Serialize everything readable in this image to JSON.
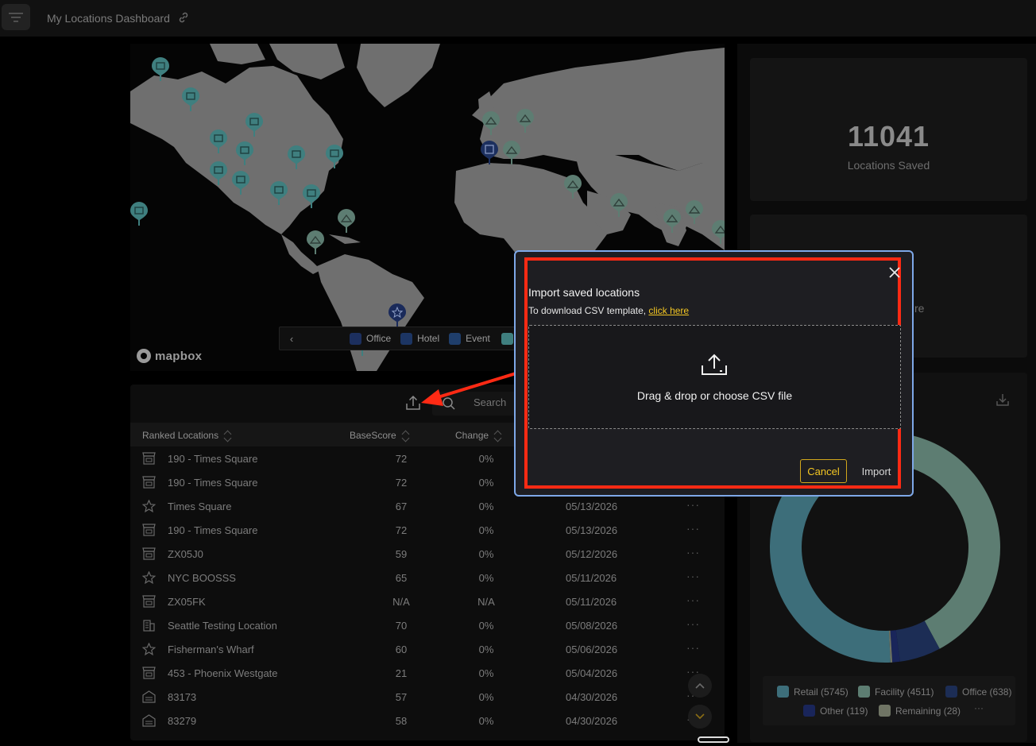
{
  "header": {
    "title": "My Locations Dashboard",
    "filter_icon": "filter-icon",
    "link_icon": "link-icon"
  },
  "map": {
    "legend": [
      {
        "label": "Office",
        "color": "#1c2f5e"
      },
      {
        "label": "Hotel",
        "color": "#1c3563"
      },
      {
        "label": "Event",
        "color": "#1f3e6b"
      }
    ],
    "attribution": "mapbox",
    "colors": {
      "land": "#8a8a8a",
      "water": "#050505",
      "pin": "#3f7f7f",
      "pin_special": "#1a2a5a"
    }
  },
  "table": {
    "search_placeholder": "Search",
    "columns": {
      "name": "Ranked Locations",
      "score": "BaseScore",
      "change": "Change"
    },
    "rows": [
      {
        "icon": "store-icon",
        "name": "190 - Times Square",
        "score": "72",
        "change": "0%",
        "date": ""
      },
      {
        "icon": "store-icon",
        "name": "190 - Times Square",
        "score": "72",
        "change": "0%",
        "date": ""
      },
      {
        "icon": "star-icon",
        "name": "Times Square",
        "score": "67",
        "change": "0%",
        "date": "05/13/2026"
      },
      {
        "icon": "store-icon",
        "name": "190 - Times Square",
        "score": "72",
        "change": "0%",
        "date": "05/13/2026"
      },
      {
        "icon": "store-icon",
        "name": "ZX05J0",
        "score": "59",
        "change": "0%",
        "date": "05/12/2026"
      },
      {
        "icon": "star-icon",
        "name": "NYC BOOSSS",
        "score": "65",
        "change": "0%",
        "date": "05/11/2026"
      },
      {
        "icon": "store-icon",
        "name": "ZX05FK",
        "score": "N/A",
        "change": "N/A",
        "date": "05/11/2026"
      },
      {
        "icon": "building-icon",
        "name": "Seattle Testing Location",
        "score": "70",
        "change": "0%",
        "date": "05/08/2026"
      },
      {
        "icon": "star-icon",
        "name": "Fisherman's Wharf",
        "score": "60",
        "change": "0%",
        "date": "05/06/2026"
      },
      {
        "icon": "store-icon",
        "name": "453 - Phoenix Westgate",
        "score": "21",
        "change": "0%",
        "date": "05/04/2026"
      },
      {
        "icon": "warehouse-icon",
        "name": "83173",
        "score": "57",
        "change": "0%",
        "date": "04/30/2026"
      },
      {
        "icon": "warehouse-icon",
        "name": "83279",
        "score": "58",
        "change": "0%",
        "date": "04/30/2026"
      }
    ],
    "more_label": "···"
  },
  "stats": {
    "saved_count": "11041",
    "saved_label": "Locations Saved",
    "card2_partial": "re"
  },
  "donut": {
    "legend": [
      {
        "label": "Retail (5745)",
        "color": "#3d6e7a"
      },
      {
        "label": "Facility (4511)",
        "color": "#5d7d72"
      },
      {
        "label": "Office (638)",
        "color": "#1c2d55"
      },
      {
        "label": "Other (119)",
        "color": "#19255a"
      },
      {
        "label": "Remaining (28)",
        "color": "#6f7464"
      }
    ],
    "more_label": "···",
    "values": [
      5745,
      4511,
      638,
      119,
      28
    ]
  },
  "modal": {
    "title": "Import saved locations",
    "subtitle": "To download CSV template, ",
    "link_label": "click here",
    "dropzone_label": "Drag & drop or choose CSV file",
    "cancel_label": "Cancel",
    "import_label": "Import",
    "colors": {
      "accent": "#f3c623",
      "highlight": "#ff2a14",
      "border": "#7ea8e8"
    }
  }
}
